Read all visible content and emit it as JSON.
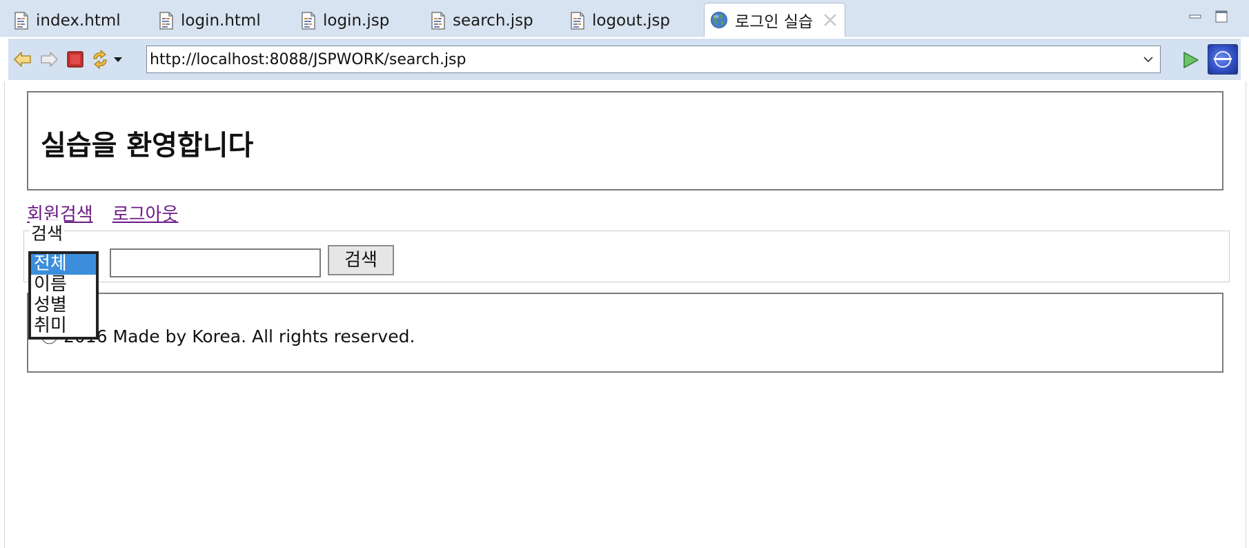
{
  "tabs": [
    {
      "label": "index.html"
    },
    {
      "label": "login.html"
    },
    {
      "label": "login.jsp"
    },
    {
      "label": "search.jsp"
    },
    {
      "label": "logout.jsp"
    },
    {
      "label": "로그인 실습"
    }
  ],
  "toolbar": {
    "url": "http://localhost:8088/JSPWORK/search.jsp"
  },
  "page": {
    "header_title": "실습을 환영합니다",
    "nav": {
      "search_link": "회원검색",
      "logout_link": "로그아웃"
    },
    "search": {
      "legend": "검색",
      "button_label": "검색",
      "input_value": "",
      "options": [
        "전체",
        "이름",
        "성별",
        "취미"
      ],
      "selected_option": "전체"
    },
    "footer_text": "ⓒ 2016 Made by Korea. All rights reserved."
  },
  "colors": {
    "tabbar_bg": "#d7e3f1",
    "toolbar_bg": "#d4e1f0",
    "link_color": "#6b1a84",
    "selected_option_bg": "#3c8edc"
  }
}
